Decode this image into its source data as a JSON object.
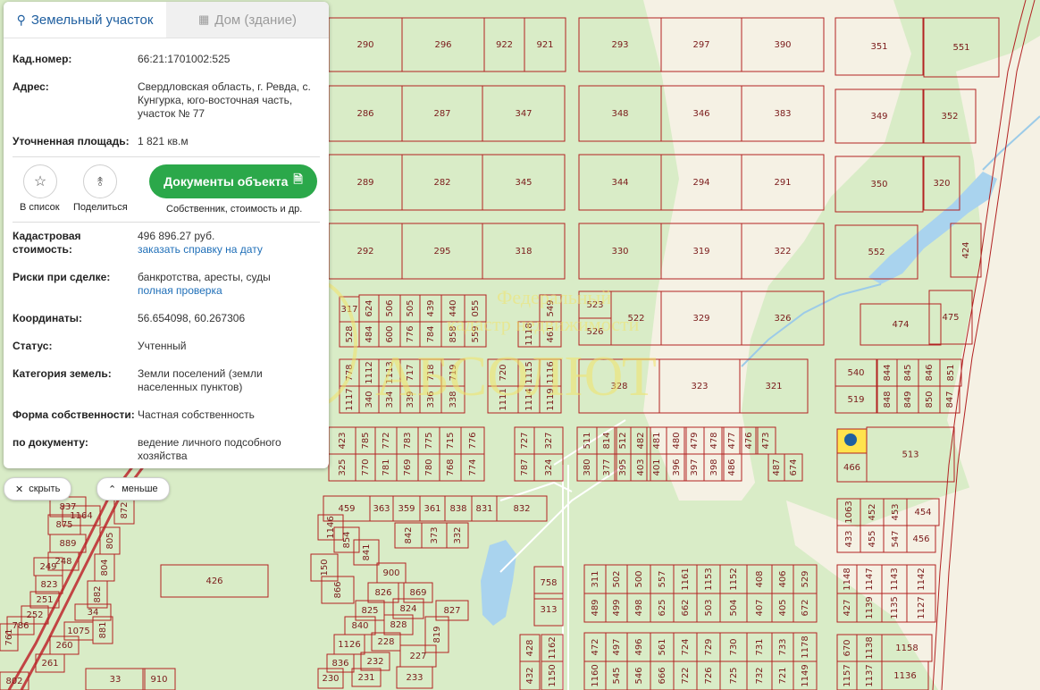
{
  "tabs": {
    "land": "Земельный участок",
    "house": "Дом (здание)"
  },
  "info": {
    "cad_label": "Кад.номер:",
    "cad_value": "66:21:1701002:525",
    "addr_label": "Адрес:",
    "addr_value": "Свердловская область, г. Ревда, с. Кунгурка, юго-восточная часть, участок № 77",
    "area_label": "Уточненная площадь:",
    "area_value": "1 821 кв.м",
    "cost_label": "Кадастровая стоимость:",
    "cost_value": "496 896.27 руб.",
    "cost_link": "заказать справку на дату",
    "risk_label": "Риски при сделке:",
    "risk_value": "банкротства, аресты, суды",
    "risk_link": "полная проверка",
    "coord_label": "Координаты:",
    "coord_value": "56.654098, 60.267306",
    "status_label": "Статус:",
    "status_value": "Учтенный",
    "category_label": "Категория земель:",
    "category_value": "Земли поселений (земли населенных пунктов)",
    "ownership_label": "Форма собственности:",
    "ownership_value": "Частная собственность",
    "doc_label": "по документу:",
    "doc_value": "ведение личного подсобного хозяйства"
  },
  "actions": {
    "list": "В список",
    "share": "Поделиться",
    "docs_button": "Документы объекта",
    "docs_sub": "Собственник, стоимость и др."
  },
  "controls": {
    "hide": "скрыть",
    "less": "меньше"
  },
  "colors": {
    "boundary": "#b22222",
    "field": "#d9ecc7",
    "clearing": "#f5f1e4",
    "water": "#a9d3ee",
    "accent_button": "#2ba84a",
    "link": "#1f6fb8",
    "selected_plot": "#ffe34d",
    "marker": "#1f5fa0"
  },
  "map": {
    "watermark": [
      "Федеральный",
      "кадастр недвижимости",
      "АБСОЛЮТ"
    ],
    "parcels": [
      {
        "label": "290"
      },
      {
        "label": "296"
      },
      {
        "label": "922"
      },
      {
        "label": "921"
      },
      {
        "label": "293"
      },
      {
        "label": "297"
      },
      {
        "label": "390"
      },
      {
        "label": "351"
      },
      {
        "label": "551"
      },
      {
        "label": "286"
      },
      {
        "label": "287"
      },
      {
        "label": "347"
      },
      {
        "label": "348"
      },
      {
        "label": "346"
      },
      {
        "label": "383"
      },
      {
        "label": "349"
      },
      {
        "label": "352"
      },
      {
        "label": "289"
      },
      {
        "label": "282"
      },
      {
        "label": "345"
      },
      {
        "label": "344"
      },
      {
        "label": "294"
      },
      {
        "label": "291"
      },
      {
        "label": "350"
      },
      {
        "label": "320"
      },
      {
        "label": "292"
      },
      {
        "label": "295"
      },
      {
        "label": "318"
      },
      {
        "label": "330"
      },
      {
        "label": "319"
      },
      {
        "label": "322"
      },
      {
        "label": "552"
      },
      {
        "label": "424"
      },
      {
        "label": "523"
      },
      {
        "label": "526"
      },
      {
        "label": "522"
      },
      {
        "label": "329"
      },
      {
        "label": "326"
      },
      {
        "label": "474"
      },
      {
        "label": "475"
      },
      {
        "label": "328"
      },
      {
        "label": "323"
      },
      {
        "label": "321"
      },
      {
        "label": "540"
      },
      {
        "label": "844"
      },
      {
        "label": "845"
      },
      {
        "label": "846"
      },
      {
        "label": "851"
      },
      {
        "label": "519"
      },
      {
        "label": "848"
      },
      {
        "label": "849"
      },
      {
        "label": "850"
      },
      {
        "label": "847"
      },
      {
        "label": "511"
      },
      {
        "label": "814"
      },
      {
        "label": "512"
      },
      {
        "label": "482"
      },
      {
        "label": "481"
      },
      {
        "label": "480"
      },
      {
        "label": "479"
      },
      {
        "label": "478"
      },
      {
        "label": "477"
      },
      {
        "label": "476"
      },
      {
        "label": "473"
      },
      {
        "label": "380"
      },
      {
        "label": "377"
      },
      {
        "label": "395"
      },
      {
        "label": "403"
      },
      {
        "label": "401"
      },
      {
        "label": "396"
      },
      {
        "label": "397"
      },
      {
        "label": "398"
      },
      {
        "label": "486"
      },
      {
        "label": "487"
      },
      {
        "label": "674"
      },
      {
        "label": "466"
      },
      {
        "label": "513"
      },
      {
        "label": "423"
      },
      {
        "label": "785"
      },
      {
        "label": "772"
      },
      {
        "label": "783"
      },
      {
        "label": "775"
      },
      {
        "label": "715"
      },
      {
        "label": "776"
      },
      {
        "label": "727"
      },
      {
        "label": "327"
      },
      {
        "label": "325"
      },
      {
        "label": "770"
      },
      {
        "label": "781"
      },
      {
        "label": "769"
      },
      {
        "label": "780"
      },
      {
        "label": "768"
      },
      {
        "label": "774"
      },
      {
        "label": "787"
      },
      {
        "label": "324"
      },
      {
        "label": "317"
      },
      {
        "label": "624"
      },
      {
        "label": "506"
      },
      {
        "label": "505"
      },
      {
        "label": "439"
      },
      {
        "label": "440"
      },
      {
        "label": "055"
      },
      {
        "label": "549"
      },
      {
        "label": "528"
      },
      {
        "label": "484"
      },
      {
        "label": "600"
      },
      {
        "label": "776"
      },
      {
        "label": "784"
      },
      {
        "label": "858"
      },
      {
        "label": "559"
      },
      {
        "label": "1118"
      },
      {
        "label": "461"
      },
      {
        "label": "778"
      },
      {
        "label": "1112"
      },
      {
        "label": "1113"
      },
      {
        "label": "717"
      },
      {
        "label": "718"
      },
      {
        "label": "719"
      },
      {
        "label": "720"
      },
      {
        "label": "1115"
      },
      {
        "label": "1116"
      },
      {
        "label": "1117"
      },
      {
        "label": "340"
      },
      {
        "label": "334"
      },
      {
        "label": "339"
      },
      {
        "label": "336"
      },
      {
        "label": "338"
      },
      {
        "label": "1111"
      },
      {
        "label": "1114"
      },
      {
        "label": "1119"
      },
      {
        "label": "459"
      },
      {
        "label": "363"
      },
      {
        "label": "359"
      },
      {
        "label": "361"
      },
      {
        "label": "838"
      },
      {
        "label": "831"
      },
      {
        "label": "832"
      },
      {
        "label": "1146"
      },
      {
        "label": "854"
      },
      {
        "label": "841"
      },
      {
        "label": "842"
      },
      {
        "label": "373"
      },
      {
        "label": "332"
      },
      {
        "label": "1063"
      },
      {
        "label": "452"
      },
      {
        "label": "453"
      },
      {
        "label": "454"
      },
      {
        "label": "433"
      },
      {
        "label": "455"
      },
      {
        "label": "547"
      },
      {
        "label": "456"
      },
      {
        "label": "426"
      },
      {
        "label": "150"
      },
      {
        "label": "866"
      },
      {
        "label": "900"
      },
      {
        "label": "869"
      },
      {
        "label": "826"
      },
      {
        "label": "824"
      },
      {
        "label": "825"
      },
      {
        "label": "828"
      },
      {
        "label": "827"
      },
      {
        "label": "840"
      },
      {
        "label": "228"
      },
      {
        "label": "819"
      },
      {
        "label": "1126"
      },
      {
        "label": "232"
      },
      {
        "label": "227"
      },
      {
        "label": "836"
      },
      {
        "label": "231"
      },
      {
        "label": "230"
      },
      {
        "label": "233"
      },
      {
        "label": "837"
      },
      {
        "label": "875"
      },
      {
        "label": "889"
      },
      {
        "label": "248"
      },
      {
        "label": "249"
      },
      {
        "label": "823"
      },
      {
        "label": "251"
      },
      {
        "label": "252"
      },
      {
        "label": "786"
      },
      {
        "label": "761"
      },
      {
        "label": "1075"
      },
      {
        "label": "260"
      },
      {
        "label": "261"
      },
      {
        "label": "802"
      },
      {
        "label": "872"
      },
      {
        "label": "805"
      },
      {
        "label": "804"
      },
      {
        "label": "882"
      },
      {
        "label": "881"
      },
      {
        "label": "1164"
      },
      {
        "label": "34"
      },
      {
        "label": "33"
      },
      {
        "label": "910"
      },
      {
        "label": "758"
      },
      {
        "label": "313"
      },
      {
        "label": "311"
      },
      {
        "label": "502"
      },
      {
        "label": "500"
      },
      {
        "label": "557"
      },
      {
        "label": "1161"
      },
      {
        "label": "1153"
      },
      {
        "label": "1152"
      },
      {
        "label": "408"
      },
      {
        "label": "406"
      },
      {
        "label": "529"
      },
      {
        "label": "489"
      },
      {
        "label": "499"
      },
      {
        "label": "498"
      },
      {
        "label": "625"
      },
      {
        "label": "662"
      },
      {
        "label": "503"
      },
      {
        "label": "504"
      },
      {
        "label": "407"
      },
      {
        "label": "405"
      },
      {
        "label": "672"
      },
      {
        "label": "1148"
      },
      {
        "label": "1147"
      },
      {
        "label": "1143"
      },
      {
        "label": "1142"
      },
      {
        "label": "427"
      },
      {
        "label": "1139"
      },
      {
        "label": "1135"
      },
      {
        "label": "1127"
      },
      {
        "label": "428"
      },
      {
        "label": "1162"
      },
      {
        "label": "472"
      },
      {
        "label": "497"
      },
      {
        "label": "496"
      },
      {
        "label": "561"
      },
      {
        "label": "724"
      },
      {
        "label": "729"
      },
      {
        "label": "730"
      },
      {
        "label": "731"
      },
      {
        "label": "733"
      },
      {
        "label": "1178"
      },
      {
        "label": "670"
      },
      {
        "label": "1138"
      },
      {
        "label": "1158"
      },
      {
        "label": "432"
      },
      {
        "label": "1150"
      },
      {
        "label": "1160"
      },
      {
        "label": "545"
      },
      {
        "label": "546"
      },
      {
        "label": "666"
      },
      {
        "label": "722"
      },
      {
        "label": "726"
      },
      {
        "label": "725"
      },
      {
        "label": "732"
      },
      {
        "label": "721"
      },
      {
        "label": "1149"
      },
      {
        "label": "1157"
      },
      {
        "label": "1137"
      },
      {
        "label": "1136"
      },
      {
        "label": "425"
      }
    ]
  }
}
